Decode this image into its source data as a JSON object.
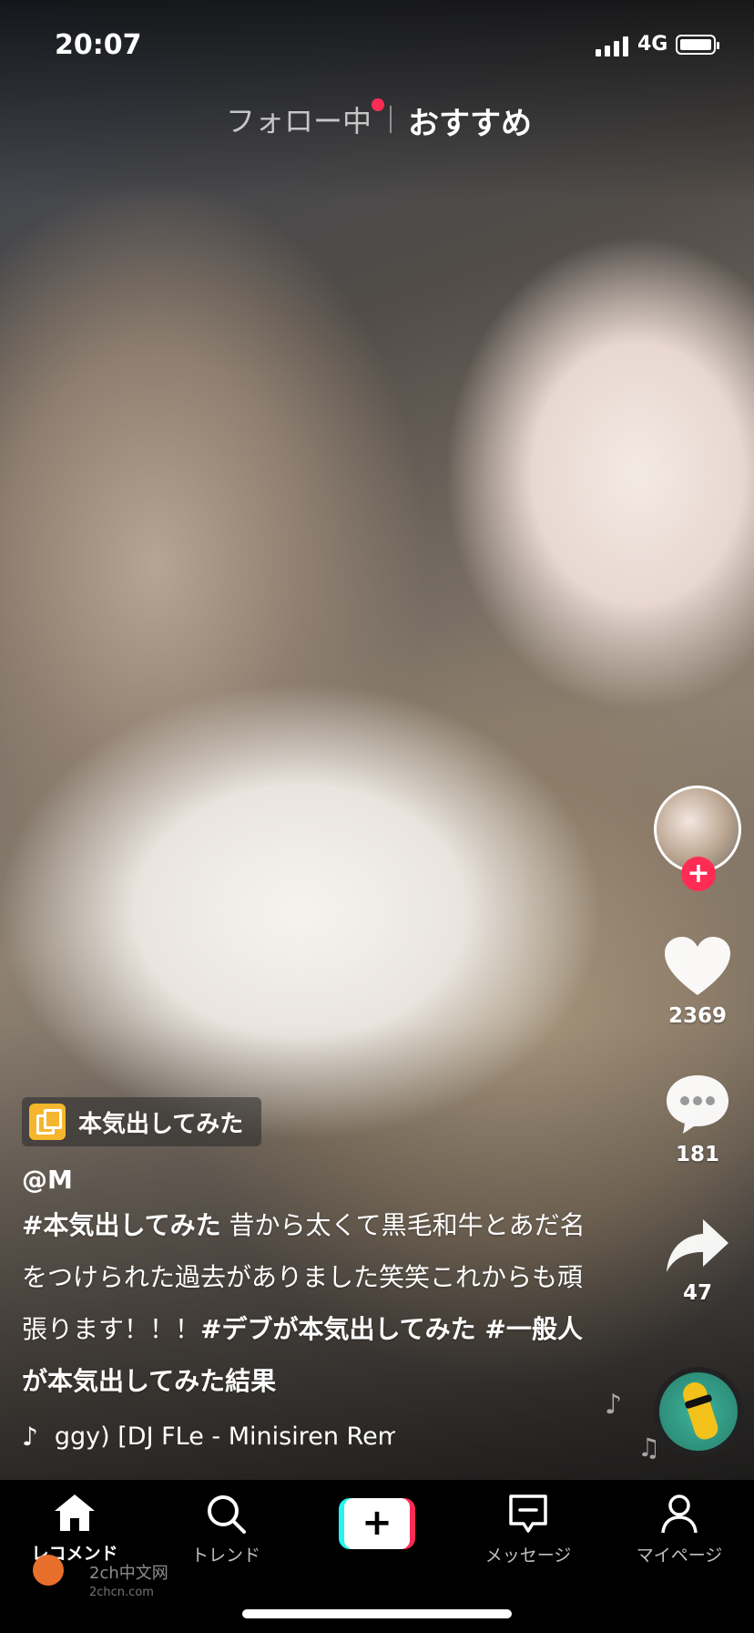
{
  "status_bar": {
    "time": "20:07",
    "network": "4G"
  },
  "top_tabs": {
    "following": "フォロー中",
    "recommended": "おすすめ"
  },
  "right_rail": {
    "likes": "2369",
    "comments": "181",
    "shares": "47"
  },
  "effect": {
    "label": "本気出してみた"
  },
  "post": {
    "username": "@M",
    "caption": {
      "tag1": "#本気出してみた",
      "text": " 昔から太くて黒毛和牛とあだ名をつけられた過去がありました笑笑これからも頑張ります！！！",
      "tag2": "#デブが本気出してみた",
      "tag3": " #一般人が本気出してみた結果"
    },
    "music": "ggy) [DJ FLe - Minisiren Rem"
  },
  "tabbar": {
    "home": "レコメンド",
    "trend": "トレンド",
    "create": "+",
    "messages": "メッセージ",
    "profile": "マイページ"
  },
  "watermark": {
    "line1": "2ch中文网",
    "line2": "2chcn.com"
  },
  "colors": {
    "accent": "#fe2c55",
    "create_left": "#25f4ee",
    "create_right": "#fe2c55"
  }
}
